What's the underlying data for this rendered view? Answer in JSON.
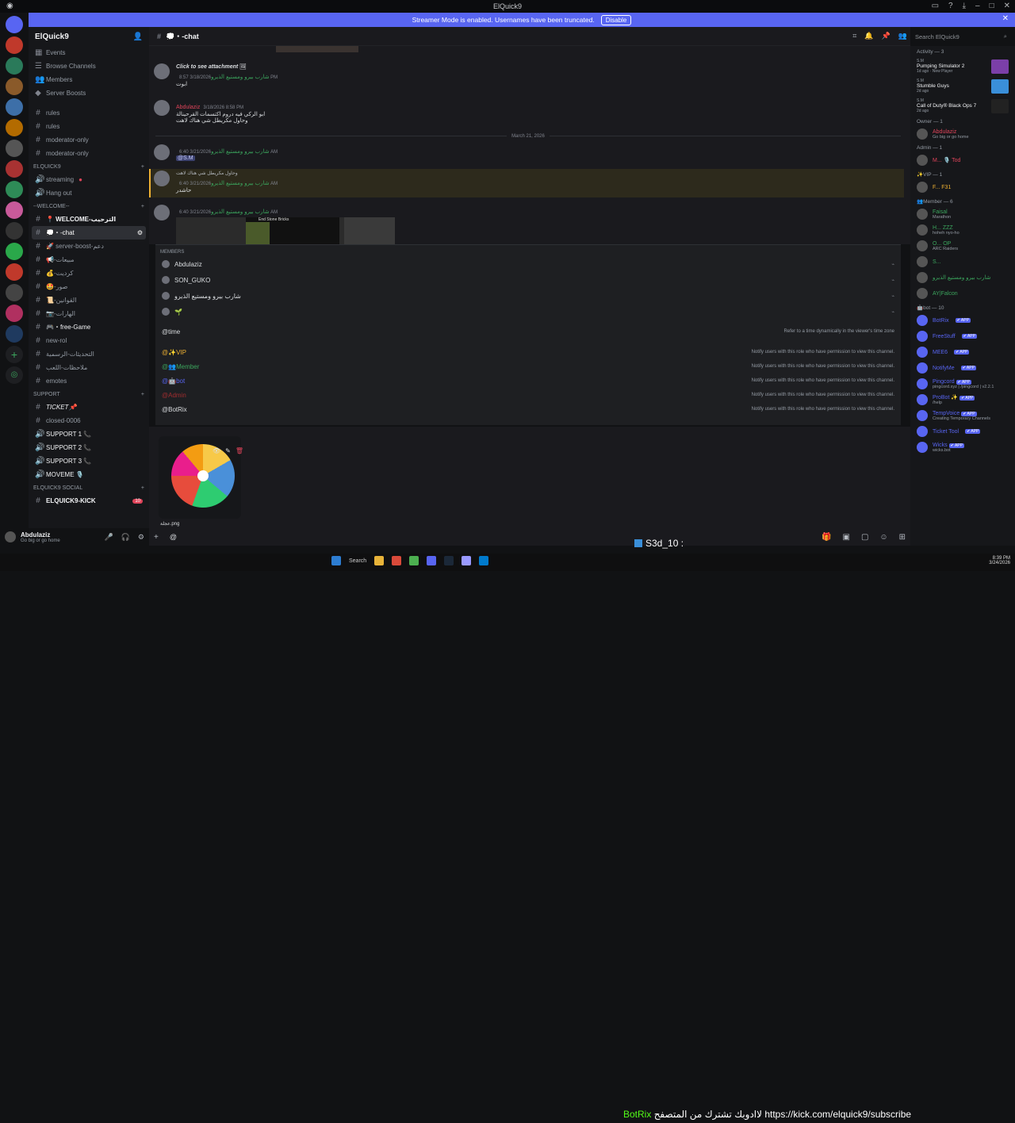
{
  "window": {
    "title": "ElQuick9"
  },
  "streamer": {
    "message": "Streamer Mode is enabled. Usernames have been truncated.",
    "button": "Disable"
  },
  "guild": {
    "name": "ElQuick9"
  },
  "sidebar": {
    "top_items": [
      "Events",
      "Browse Channels",
      "Members",
      "Server Boosts"
    ],
    "channels_a": [
      "rules",
      "rules",
      "moderator-only",
      "moderator-only"
    ],
    "cat_elquick9": "ElQuick9",
    "voice": [
      "streaming",
      "Hang out"
    ],
    "cat_welcome": "-‑WELCOME‑‑",
    "welcome_items": [
      "📍 WELCOME-الترحيب",
      "💭・‑chat",
      "🚀 server-boost-دعم",
      "📢-مبيعات",
      "💰-كرديت",
      "🤩-صور",
      "📜-القوانين",
      "📷-الهارات",
      "🎮・free-Game",
      "new-rol",
      "التحديثات-الرسمية",
      "ملاحظات-اللعب",
      "emotes"
    ],
    "cat_support": "SUPPORT",
    "support_items": [
      "TICKET📌",
      "closed-0006",
      "SUPPORT 1 📞",
      "SUPPORT 2 📞",
      "SUPPORT 3 📞",
      "MOVEME 🎙️"
    ],
    "cat_social": "ELQUICK9 SOCIAL",
    "social_item": "ELQUICK9-KICK",
    "social_badge": "10"
  },
  "user": {
    "name": "Abdulaziz",
    "status": "Go big or go home"
  },
  "channel": {
    "name": "💭・‑chat",
    "search_placeholder": "Search ElQuick9"
  },
  "messages": [
    {
      "name": "شارب بيرو ومستيع الذيرو",
      "time": "",
      "text": "Click to see attachment"
    },
    {
      "name": "شارب بيرو ومستيع الذيرو",
      "time": "3/18/2026 8:57 PM",
      "text": "ابوت"
    },
    {
      "name": "Abdulaziz",
      "time": "3/18/2026 8:58 PM",
      "text": "ابو الركي فيه دروم اكتسمات القرحينالة"
    },
    {
      "name": "",
      "time": "",
      "text": "وحاول مكريطل شي هناك لاهت"
    },
    {
      "name": "شارب بيرو ومستيع الذيرو",
      "time": "3/21/2026 6:40 AM",
      "text": "@S.M"
    },
    {
      "name": "شارب بيرو ومستيع الذيرو",
      "time": "3/21/2026 6:40 AM",
      "text": "حاشدر"
    },
    {
      "name": "شارب بيرو ومستيع الذيرو",
      "time": "3/21/2026 6:40 AM",
      "text": ""
    }
  ],
  "reply_snippet": "وحاول مكريطل شي هناك لاهت",
  "date_divider": "March 21, 2026",
  "embed_title": "End Stone Bricks",
  "autocomplete": {
    "members_header": "MEMBERS",
    "members": [
      "Abdulaziz",
      "SON_GUKO",
      "شارب بيرو ومستيع الذيرو",
      "🌱"
    ],
    "time_label": "@time",
    "time_desc": "Refer to a time dynamically in the viewer's time zone",
    "roles": [
      {
        "label": "@✨VIP",
        "color": "#f0b232"
      },
      {
        "label": "@👥Member",
        "color": "#3ba55d"
      },
      {
        "label": "@🤖bot",
        "color": "#5865f2"
      },
      {
        "label": "@Admin",
        "color": "#a12d2f"
      },
      {
        "label": "@BotRix",
        "color": "#dbdee1"
      }
    ],
    "role_desc": "Notify users with this role who have permission to view this channel."
  },
  "attachment": {
    "filename": "عجلة.png"
  },
  "composer": {
    "value": "@"
  },
  "members_panel": {
    "activity_header": "Activity — 3",
    "activities": [
      {
        "user": "S.M",
        "game": "Pumping Simulator 2",
        "sub": "1d ago · New Player"
      },
      {
        "user": "S.M",
        "game": "Stumble Guys",
        "sub": "2d ago"
      },
      {
        "user": "S.M",
        "game": "Call of Duty® Black Ops 7",
        "sub": "2d ago"
      }
    ],
    "groups": [
      {
        "header": "Owner — 1",
        "members": [
          {
            "name": "Abdulaziz",
            "sub": "Go big or go home"
          }
        ]
      },
      {
        "header": "Admin — 1",
        "members": [
          {
            "name": "M... 🎙️ Tod",
            "sub": ""
          }
        ]
      },
      {
        "header": "✨VIP — 1",
        "members": [
          {
            "name": "F... F31",
            "sub": ""
          }
        ]
      },
      {
        "header": "👥Member — 6",
        "members": [
          {
            "name": "Faisal",
            "sub": "Marathon"
          },
          {
            "name": "H... ZZZ",
            "sub": "hoheh nyo-ho"
          },
          {
            "name": "O... OP",
            "sub": "ARC Raiders"
          },
          {
            "name": "S...",
            "sub": ""
          },
          {
            "name": "شارب بيرو ومستيع الذيرو",
            "sub": ""
          },
          {
            "name": "AY|Falcon",
            "sub": ""
          }
        ]
      },
      {
        "header": "🤖bot — 10",
        "members": [
          {
            "name": "BotRix",
            "sub": ""
          },
          {
            "name": "FreeStuff",
            "sub": ""
          },
          {
            "name": "MEE6",
            "sub": ""
          },
          {
            "name": "NotifyMe",
            "sub": ""
          },
          {
            "name": "Pingcord",
            "sub": "pingcord.xyz | /pingcord | v2.2.1"
          },
          {
            "name": "ProBot ✨",
            "sub": "/help"
          },
          {
            "name": "TempVoice",
            "sub": "Creating Temporary Channels"
          },
          {
            "name": "Ticket Tool",
            "sub": ""
          },
          {
            "name": "Wicks",
            "sub": "wicks.bot"
          }
        ]
      }
    ],
    "app_badge": "✔ APP"
  },
  "overlay": {
    "kick_user": "S3d_10 :",
    "bot_name": "BotRix",
    "bot_msg": "لاادوبك تشترك من المتصفح",
    "url": "https://kick.com/elquick9/subscribe"
  },
  "taskbar": {
    "search": "Search",
    "time": "8:39 PM",
    "date": "3/24/2026"
  },
  "colors": {
    "accent": "#5865f2",
    "online": "#3ba55d",
    "owner": "#e0445a"
  }
}
